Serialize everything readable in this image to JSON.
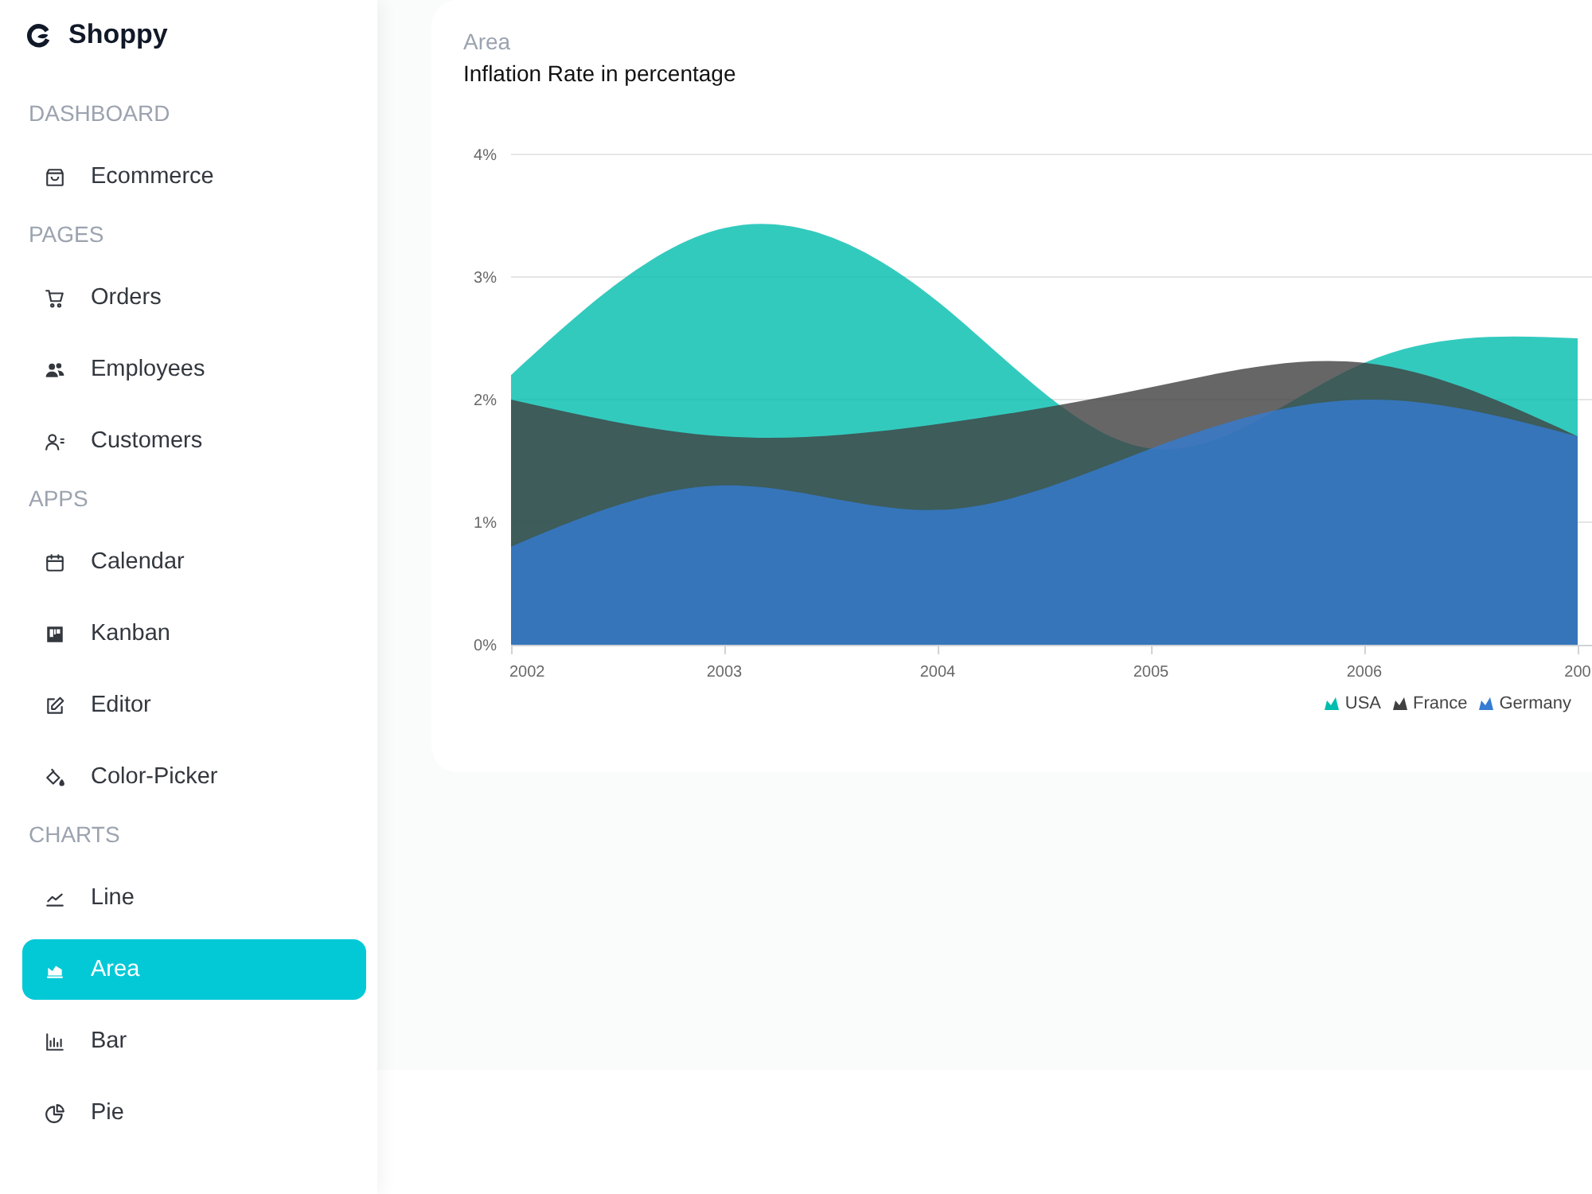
{
  "sidebar": {
    "logo": "Shoppy",
    "sections": [
      {
        "heading": "DASHBOARD",
        "items": [
          {
            "label": "Ecommerce",
            "selected": false
          }
        ]
      },
      {
        "heading": "PAGES",
        "items": [
          {
            "label": "Orders",
            "selected": false
          },
          {
            "label": "Employees",
            "selected": false
          },
          {
            "label": "Customers",
            "selected": false
          }
        ]
      },
      {
        "heading": "APPS",
        "items": [
          {
            "label": "Calendar",
            "selected": false
          },
          {
            "label": "Kanban",
            "selected": false
          },
          {
            "label": "Editor",
            "selected": false
          },
          {
            "label": "Color-Picker",
            "selected": false
          }
        ]
      },
      {
        "heading": "CHARTS",
        "items": [
          {
            "label": "Line",
            "selected": false
          },
          {
            "label": "Area",
            "selected": true
          },
          {
            "label": "Bar",
            "selected": false
          },
          {
            "label": "Pie",
            "selected": false
          }
        ]
      }
    ]
  },
  "card": {
    "category": "Area",
    "title": "Inflation Rate in percentage",
    "chart_data": {
      "type": "area",
      "grid": true,
      "categories": [
        "2002",
        "2003",
        "2004",
        "2005",
        "2006",
        "200"
      ],
      "series": [
        {
          "name": "USA",
          "color": "#00bdae",
          "values": [
            2.2,
            3.4,
            2.8,
            1.6,
            2.3,
            2.5
          ]
        },
        {
          "name": "France",
          "color": "#404041",
          "values": [
            2.0,
            1.7,
            1.8,
            2.1,
            2.3,
            1.7
          ]
        },
        {
          "name": "Germany",
          "color": "#357cd2",
          "values": [
            0.8,
            1.3,
            1.1,
            1.6,
            2.0,
            1.7
          ]
        }
      ],
      "ylim": [
        0,
        4
      ],
      "yticks": [
        {
          "value": 0,
          "label": "0%"
        },
        {
          "value": 1,
          "label": "1%"
        },
        {
          "value": 2,
          "label": "2%"
        },
        {
          "value": 3,
          "label": "3%"
        },
        {
          "value": 4,
          "label": "4%"
        }
      ]
    }
  }
}
